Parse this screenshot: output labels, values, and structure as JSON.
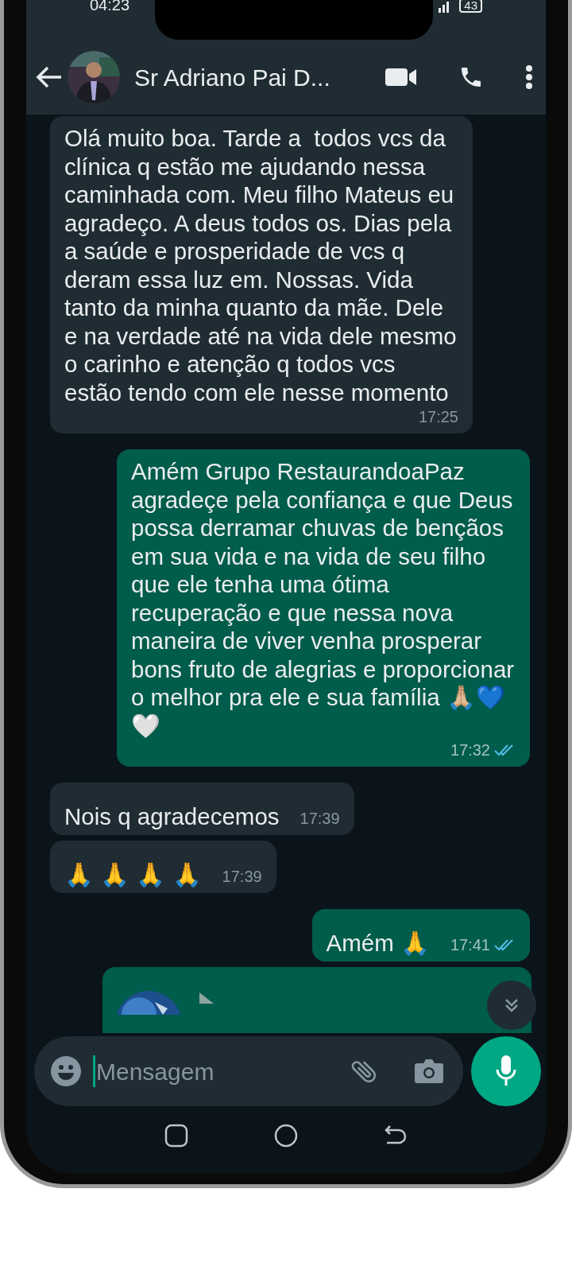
{
  "status_bar": {
    "time": "04:23",
    "battery": "43"
  },
  "header": {
    "contact_name": "Sr Adriano Pai D..."
  },
  "messages": [
    {
      "outgoing": false,
      "kind": "text",
      "text": "Olá muito boa. Tarde a  todos vcs da clínica q estão me ajudando nessa caminhada com. Meu filho Mateus eu agradeço. A deus todos os. Dias pela a saúde e prosperidade de vcs q deram essa luz em. Nossas. Vida tanto da minha quanto da mãe. Dele e na verdade até na vida dele mesmo o carinho e atenção q todos vcs estão tendo com ele nesse momento",
      "time": "17:25"
    },
    {
      "outgoing": true,
      "kind": "text",
      "text": "Amém Grupo RestaurandoaPaz agradeçe pela confiança e que Deus possa derramar chuvas de bençãos em sua vida e na vida de seu filho que ele tenha uma ótima recuperação e que nessa nova maneira de viver venha prosperar bons fruto de alegrias e proporcionar o melhor pra ele e sua família 🙏🏼💙 🤍",
      "time": "17:32",
      "read": true
    },
    {
      "outgoing": false,
      "kind": "text",
      "text": "Nois q agradecemos",
      "time": "17:39"
    },
    {
      "outgoing": false,
      "kind": "text",
      "text": "🙏 🙏 🙏 🙏",
      "time": "17:39"
    },
    {
      "outgoing": true,
      "kind": "text",
      "text": "Amém 🙏",
      "time": "17:41",
      "read": true
    },
    {
      "outgoing": true,
      "kind": "audio"
    }
  ],
  "composer": {
    "placeholder": "Mensagem"
  }
}
